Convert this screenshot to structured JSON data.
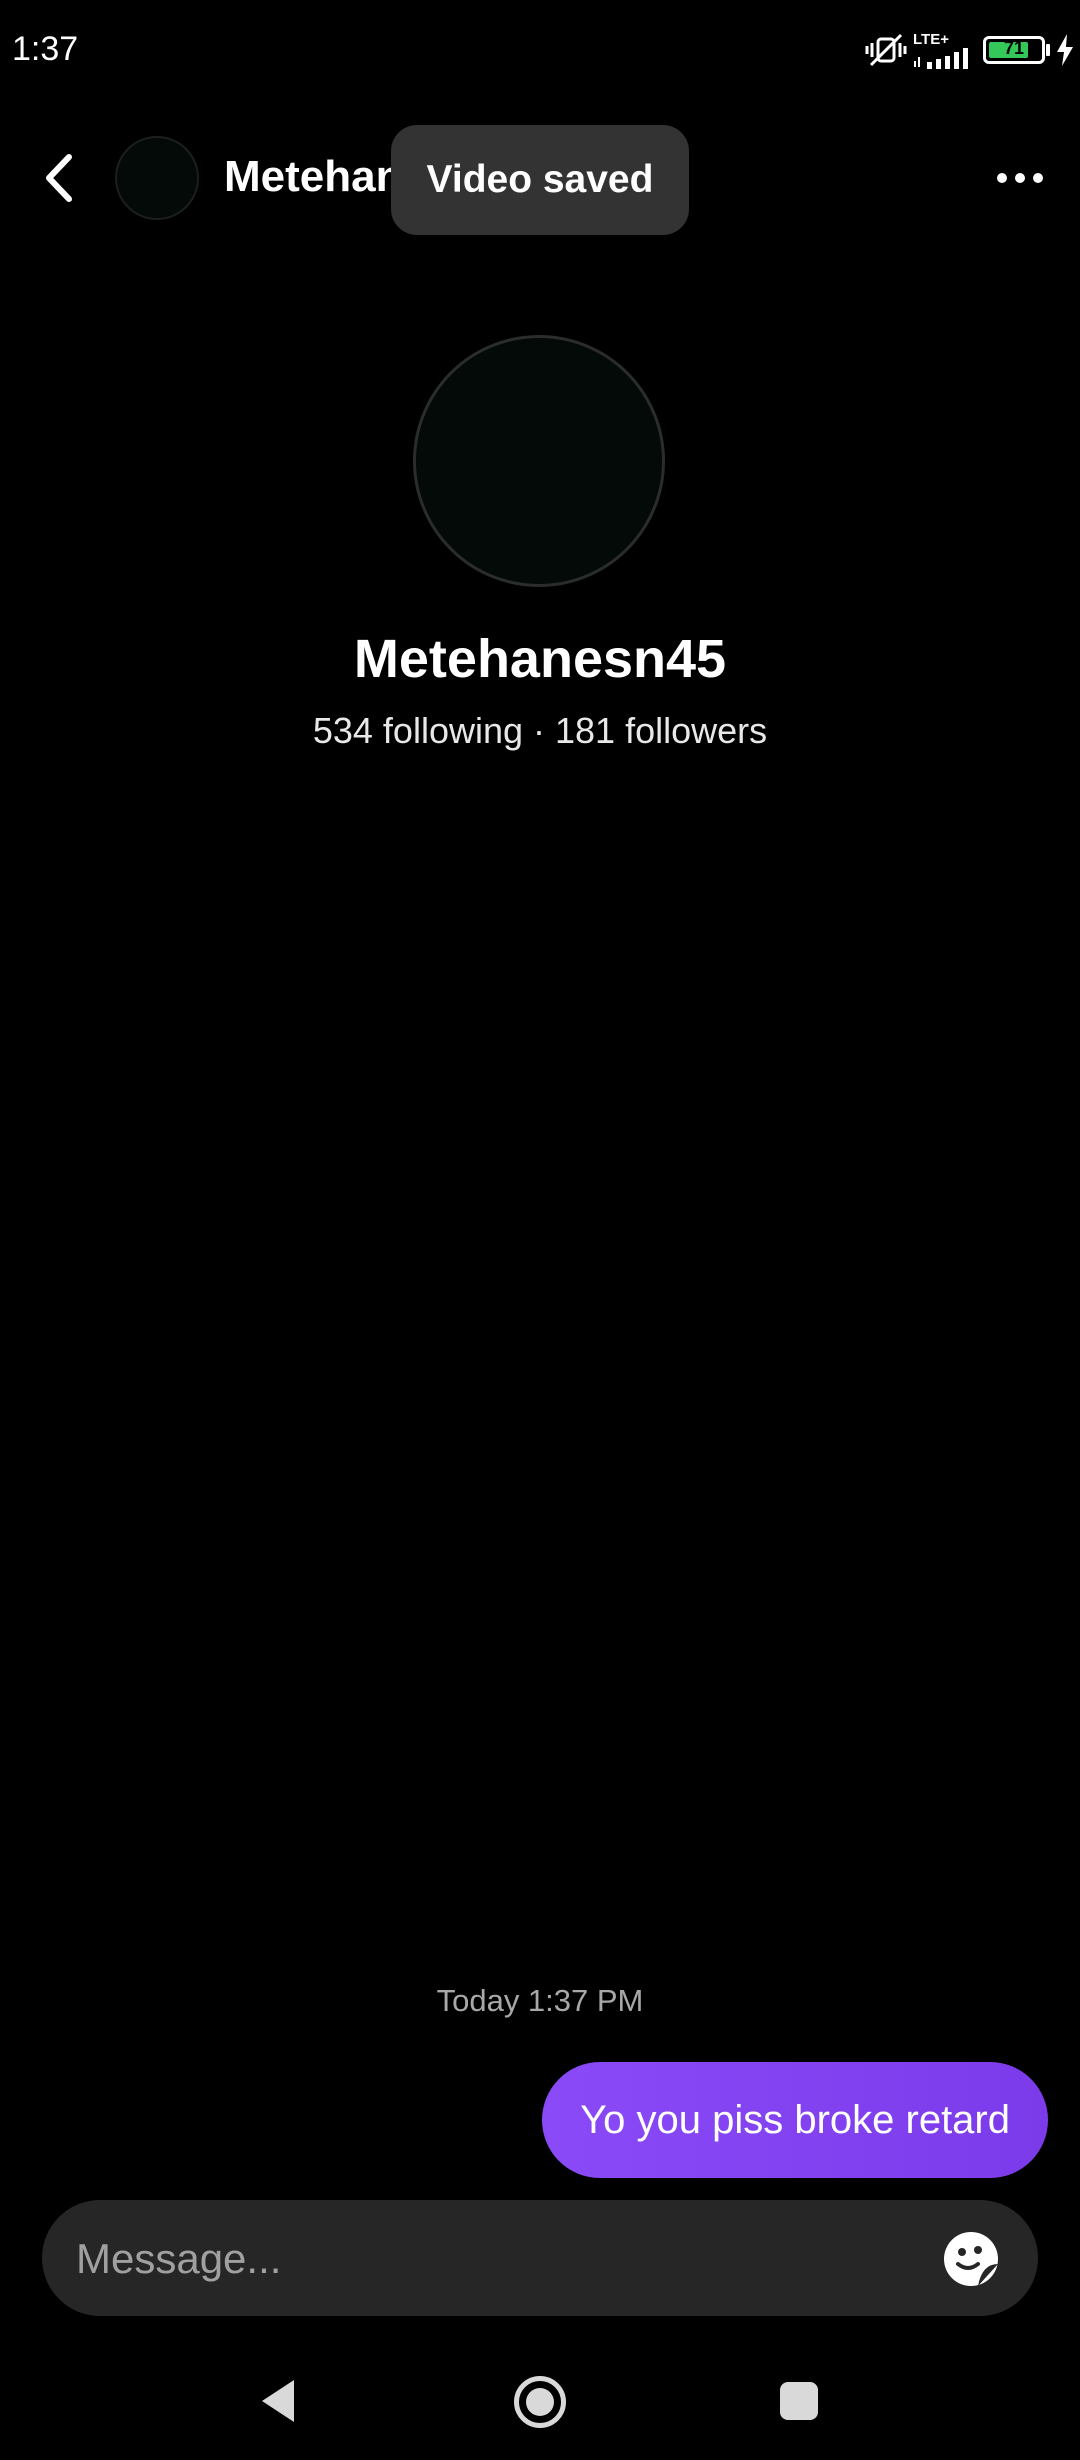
{
  "status_bar": {
    "time": "1:37",
    "network": "LTE+",
    "battery_level": "71",
    "icons": [
      "vibrate-mute-icon",
      "signal-icon",
      "battery-icon",
      "charging-icon"
    ]
  },
  "header": {
    "name": "Metehan",
    "icons": [
      "chevron-left-icon",
      "more-horizontal-icon"
    ]
  },
  "toast": {
    "text": "Video saved"
  },
  "profile": {
    "username": "Metehanesn45",
    "stats": "534 following · 181 followers"
  },
  "conversation": {
    "timestamp": "Today 1:37 PM",
    "messages": [
      {
        "text": "Yo you piss broke retard",
        "sender": "me"
      }
    ]
  },
  "composer": {
    "placeholder": "Message...",
    "icon": "sticker-icon"
  },
  "colors": {
    "background": "#000000",
    "bubble_accent": "#8a4af8",
    "composer_bg": "#262626",
    "toast_bg": "#333333",
    "battery_green": "#34c759"
  }
}
